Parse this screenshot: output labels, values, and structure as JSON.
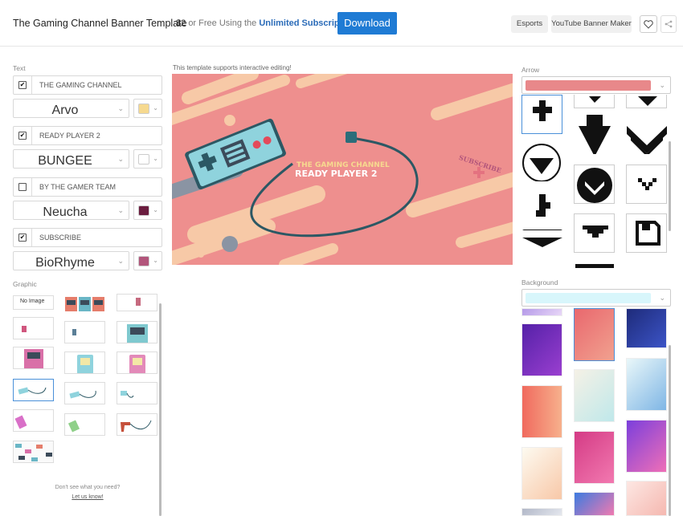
{
  "header": {
    "title": "The Gaming Channel Banner Template",
    "price_amount": "$2",
    "price_text": "or Free Using the",
    "price_link": "Unlimited Subscription",
    "download_label": "Download",
    "tags": [
      "Esports",
      "YouTube Banner Maker"
    ],
    "icons": [
      "heart-icon",
      "share-icon"
    ]
  },
  "text_panel": {
    "label": "Text",
    "rows": [
      {
        "checked": true,
        "value": "THE GAMING CHANNEL",
        "font": "Arvo",
        "color": "#f6d98f"
      },
      {
        "checked": true,
        "value": "READY PLAYER 2",
        "font": "BUNGEE",
        "color": "#ffffff"
      },
      {
        "checked": false,
        "value": "BY THE GAMER TEAM",
        "font": "Neucha",
        "color": "#6b1d3f"
      },
      {
        "checked": true,
        "value": "SUBSCRIBE",
        "font": "BioRhyme",
        "color": "#b2557b"
      }
    ]
  },
  "graphic_panel": {
    "label": "Graphic",
    "no_image_label": "No Image",
    "help_line1": "Don't see what you need?",
    "help_link": "Let us know!"
  },
  "editor": {
    "note": "This template supports interactive editing!",
    "banner": {
      "line1": "THE GAMING CHANNEL",
      "line2": "READY PLAYER 2",
      "subscribe": "SUBSCRIBE",
      "colors": {
        "background": "#ee8f8e",
        "stripe": "#f7c9a7",
        "controller": "#8fd3dd"
      }
    }
  },
  "arrow_panel": {
    "label": "Arrow",
    "selected_color": "#e8888a"
  },
  "background_panel": {
    "label": "Background",
    "selected_color": "#d8f6fb"
  }
}
